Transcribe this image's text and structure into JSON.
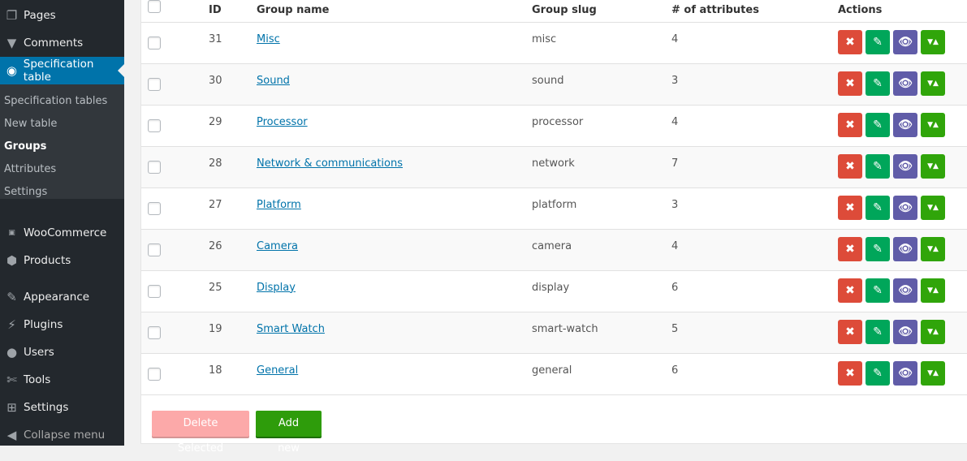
{
  "sidebar": {
    "items": [
      {
        "label": "Pages",
        "icon": "pages-icon"
      },
      {
        "label": "Comments",
        "icon": "comments-icon"
      },
      {
        "label": "Specification table",
        "icon": "specification-icon"
      },
      {
        "label": "WooCommerce",
        "icon": "woocommerce-icon"
      },
      {
        "label": "Products",
        "icon": "products-icon"
      },
      {
        "label": "Appearance",
        "icon": "appearance-icon"
      },
      {
        "label": "Plugins",
        "icon": "plugins-icon"
      },
      {
        "label": "Users",
        "icon": "users-icon"
      },
      {
        "label": "Tools",
        "icon": "tools-icon"
      },
      {
        "label": "Settings",
        "icon": "settings-icon"
      },
      {
        "label": "Collapse menu",
        "icon": "collapse-icon"
      }
    ],
    "submenu": [
      "Specification tables",
      "New table",
      "Groups",
      "Attributes",
      "Settings"
    ],
    "active_color": "#0073aa"
  },
  "table": {
    "headers": [
      "ID",
      "Group name",
      "Group slug",
      "# of attributes",
      "Actions"
    ],
    "rows": [
      {
        "id": "31",
        "name": "Misc",
        "slug": "misc",
        "count": "4"
      },
      {
        "id": "30",
        "name": "Sound",
        "slug": "sound",
        "count": "3"
      },
      {
        "id": "29",
        "name": "Processor",
        "slug": "processor",
        "count": "4"
      },
      {
        "id": "28",
        "name": "Network & communications",
        "slug": "network",
        "count": "7"
      },
      {
        "id": "27",
        "name": "Platform",
        "slug": "platform",
        "count": "3"
      },
      {
        "id": "26",
        "name": "Camera",
        "slug": "camera",
        "count": "4"
      },
      {
        "id": "25",
        "name": "Display",
        "slug": "display",
        "count": "6"
      },
      {
        "id": "19",
        "name": "Smart Watch",
        "slug": "smart-watch",
        "count": "5"
      },
      {
        "id": "18",
        "name": "General",
        "slug": "general",
        "count": "6"
      }
    ],
    "action_colors": {
      "delete": "#dd4b39",
      "edit": "#00a65a",
      "view": "#605ca8",
      "move": "#30a50a"
    }
  },
  "buttons": {
    "delete_selected": "Delete Selected",
    "add_new": "Add new"
  }
}
